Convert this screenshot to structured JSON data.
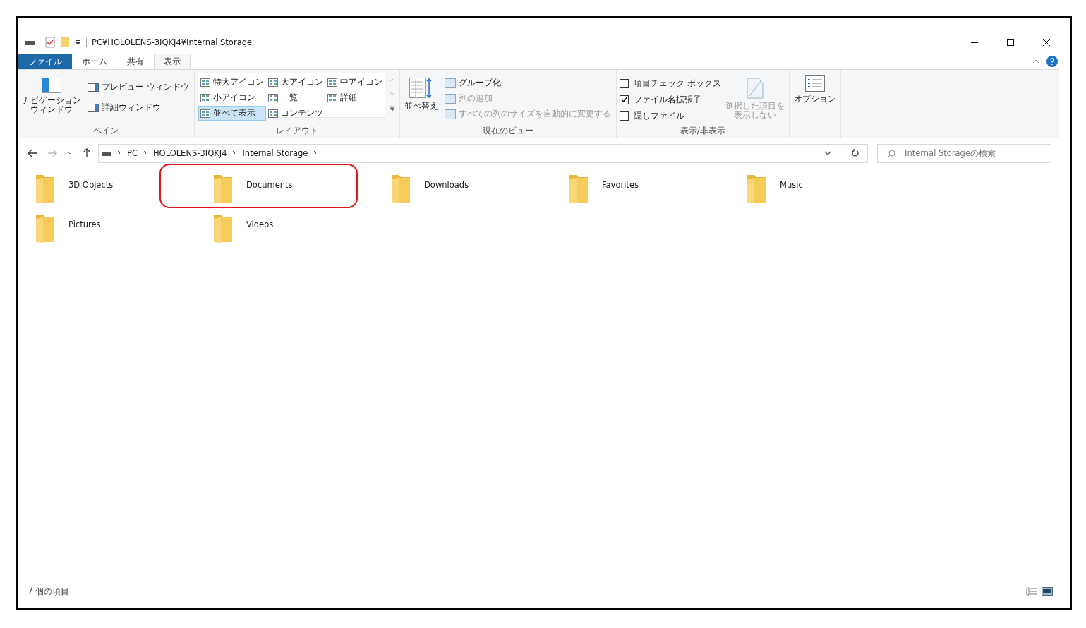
{
  "window": {
    "title": "PC¥HOLOLENS-3IQKJ4¥Internal Storage"
  },
  "ribbon_tabs": [
    {
      "label": "ファイル",
      "kind": "file",
      "selected": false
    },
    {
      "label": "ホーム",
      "kind": "tab",
      "selected": false
    },
    {
      "label": "共有",
      "kind": "tab",
      "selected": false
    },
    {
      "label": "表示",
      "kind": "tab",
      "selected": true
    }
  ],
  "pane_group": {
    "navigation_pane": [
      "ナビゲーション",
      "ウィンドウ"
    ],
    "preview_pane": "プレビュー ウィンドウ",
    "details_pane": "詳細ウィンドウ",
    "label": "ペイン"
  },
  "layout_group": {
    "options": [
      {
        "label": "特大アイコン",
        "selected": false
      },
      {
        "label": "大アイコン",
        "selected": false
      },
      {
        "label": "中アイコン",
        "selected": false
      },
      {
        "label": "小アイコン",
        "selected": false
      },
      {
        "label": "一覧",
        "selected": false
      },
      {
        "label": "詳細",
        "selected": false
      },
      {
        "label": "並べて表示",
        "selected": true
      },
      {
        "label": "コンテンツ",
        "selected": false
      }
    ],
    "label": "レイアウト"
  },
  "current_view_group": {
    "sort": "並べ替え",
    "items": [
      {
        "label": "グループ化",
        "disabled": false
      },
      {
        "label": "列の追加",
        "disabled": true
      },
      {
        "label": "すべての列のサイズを自動的に変更する",
        "disabled": true
      }
    ],
    "label": "現在のビュー"
  },
  "show_hide_group": {
    "checkboxes": [
      {
        "label": "項目チェック ボックス",
        "checked": false
      },
      {
        "label": "ファイル名拡張子",
        "checked": true
      },
      {
        "label": "隠しファイル",
        "checked": false
      }
    ],
    "hide_selected": {
      "lines": [
        "選択した項目を",
        "表示しない"
      ],
      "disabled": true
    },
    "label": "表示/非表示"
  },
  "options_button": "オプション",
  "address_bar": {
    "crumbs": [
      "PC",
      "HOLOLENS-3IQKJ4",
      "Internal Storage"
    ]
  },
  "search": {
    "placeholder": "Internal Storageの検索"
  },
  "folders": [
    {
      "name": "3D Objects",
      "highlighted": false
    },
    {
      "name": "Documents",
      "highlighted": true
    },
    {
      "name": "Downloads",
      "highlighted": false
    },
    {
      "name": "Favorites",
      "highlighted": false
    },
    {
      "name": "Music",
      "highlighted": false
    },
    {
      "name": "Pictures",
      "highlighted": false
    },
    {
      "name": "Videos",
      "highlighted": false
    }
  ],
  "status_bar": {
    "item_count": "7 個の項目"
  }
}
